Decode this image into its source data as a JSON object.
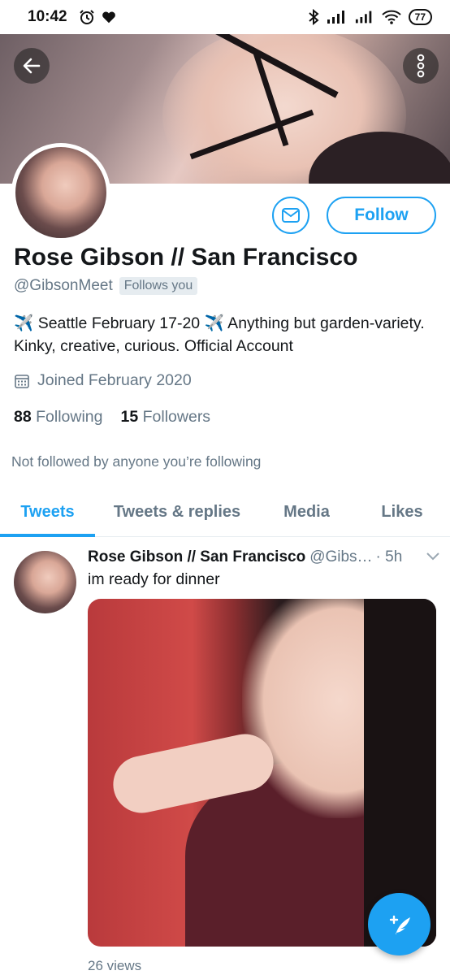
{
  "status_bar": {
    "time": "10:42",
    "battery": "77"
  },
  "profile": {
    "display_name": "Rose Gibson // San Francisco",
    "handle": "@GibsonMeet",
    "follows_you_badge": "Follows you",
    "bio": "✈️ Seattle February 17-20 ✈️ Anything but garden-variety. Kinky, creative, curious.  Official Account",
    "joined": "Joined February 2020",
    "following_count": "88",
    "following_label": "Following",
    "followers_count": "15",
    "followers_label": "Followers",
    "not_followed_text": "Not followed by anyone you’re following",
    "follow_label": "Follow"
  },
  "tabs": [
    {
      "label": "Tweets",
      "active": true
    },
    {
      "label": "Tweets & replies",
      "active": false
    },
    {
      "label": "Media",
      "active": false
    },
    {
      "label": "Likes",
      "active": false
    }
  ],
  "tweet": {
    "name": "Rose Gibson // San Francisco",
    "handle": "@Gibs…",
    "time": "· 5h",
    "text": "im ready for dinner",
    "views": "26 views"
  },
  "colors": {
    "accent": "#1da1f2",
    "muted": "#657786",
    "text": "#14171a"
  },
  "icons": [
    "alarm-icon",
    "heart-icon",
    "bluetooth-icon",
    "signal-icon",
    "wifi-icon",
    "back-arrow-icon",
    "more-vertical-icon",
    "mail-icon",
    "calendar-icon",
    "chevron-down-icon",
    "compose-icon"
  ]
}
